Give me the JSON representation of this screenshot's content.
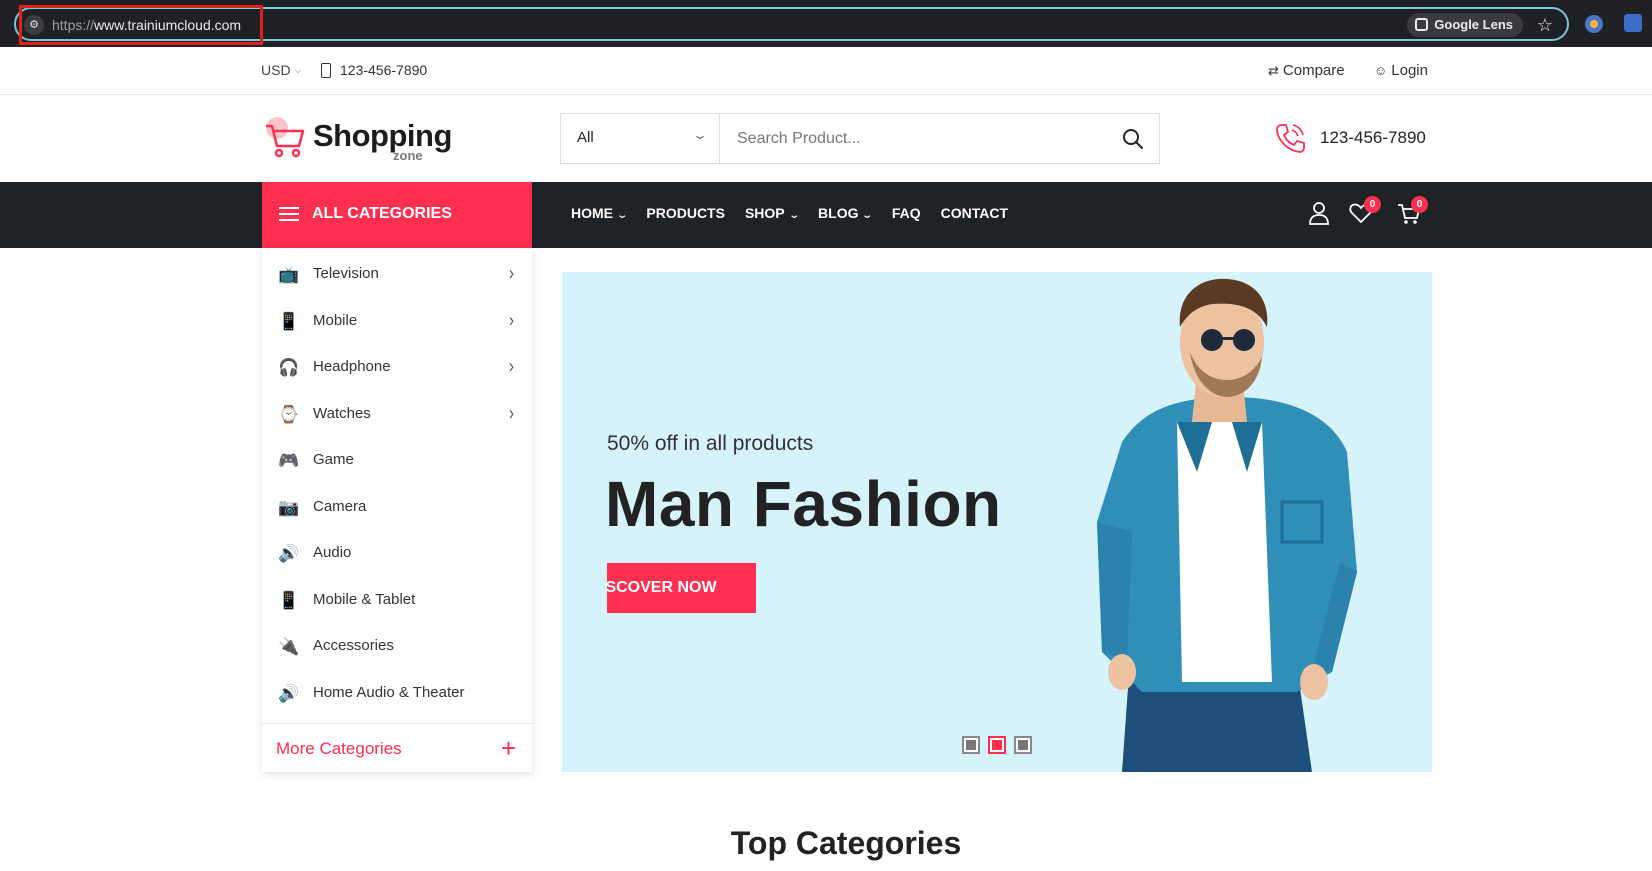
{
  "browser": {
    "url_scheme": "https://",
    "url_host": "www.trainiumcloud.com",
    "lens_label": "Google Lens"
  },
  "topbar": {
    "currency": "USD",
    "phone": "123-456-7890",
    "compare_label": "Compare",
    "login_label": "Login"
  },
  "header": {
    "logo_text": "Shopping",
    "logo_sub": "zone",
    "category_select": "All",
    "search_placeholder": "Search Product...",
    "phone": "123-456-7890"
  },
  "nav": {
    "all_categories_label": "ALL CATEGORIES",
    "items": [
      {
        "label": "HOME",
        "dropdown": true
      },
      {
        "label": "PRODUCTS",
        "dropdown": false
      },
      {
        "label": "SHOP",
        "dropdown": true
      },
      {
        "label": "BLOG",
        "dropdown": true
      },
      {
        "label": "FAQ",
        "dropdown": false
      },
      {
        "label": "CONTACT",
        "dropdown": false
      }
    ],
    "wishlist_count": "0",
    "cart_count": "0"
  },
  "sidebar": {
    "items": [
      {
        "label": "Television",
        "icon": "tv-icon",
        "has_submenu": true
      },
      {
        "label": "Mobile",
        "icon": "mobile-icon",
        "has_submenu": true
      },
      {
        "label": "Headphone",
        "icon": "headphone-icon",
        "has_submenu": true
      },
      {
        "label": "Watches",
        "icon": "watch-icon",
        "has_submenu": true
      },
      {
        "label": "Game",
        "icon": "gamepad-icon",
        "has_submenu": false
      },
      {
        "label": "Camera",
        "icon": "camera-icon",
        "has_submenu": false
      },
      {
        "label": "Audio",
        "icon": "speaker-icon",
        "has_submenu": false
      },
      {
        "label": "Mobile & Tablet",
        "icon": "tablet-icon",
        "has_submenu": false
      },
      {
        "label": "Accessories",
        "icon": "plug-icon",
        "has_submenu": false
      },
      {
        "label": "Home Audio & Theater",
        "icon": "speaker-icon",
        "has_submenu": false
      }
    ],
    "more_label": "More Categories"
  },
  "hero": {
    "subtitle": "50% off in all products",
    "title": "Man Fashion",
    "button_label": "ISCOVER NOW",
    "slides": 3,
    "active_slide": 2,
    "background": "#d6f3fc"
  },
  "section": {
    "title": "Top Categories"
  },
  "colors": {
    "accent": "#ff2f4f",
    "nav_bg": "#1f2326"
  }
}
